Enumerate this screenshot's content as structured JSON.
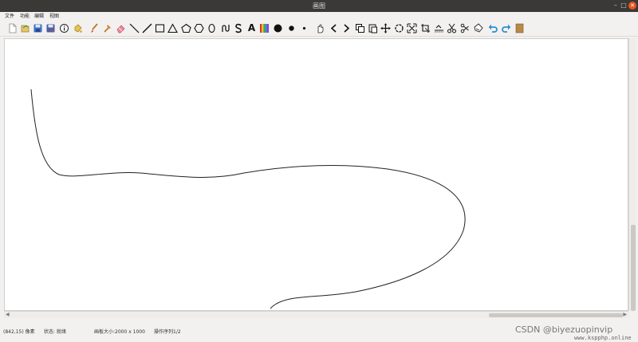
{
  "window": {
    "title": "画图"
  },
  "menu": {
    "file": "文件",
    "function": "功能",
    "edit": "编辑",
    "view": "视图"
  },
  "toolbar": {
    "tools": [
      "new-file-icon",
      "open-file-icon",
      "save-icon",
      "save-as-icon",
      "info-icon",
      "fill-bucket-icon",
      "brush-icon",
      "hammer-icon",
      "eraser-icon",
      "line-thin-icon",
      "line-thick-icon",
      "rectangle-icon",
      "triangle-icon",
      "pentagon-icon",
      "polygon-icon",
      "ellipse-icon",
      "curve-icon",
      "s-curve-icon",
      "text-icon",
      "color-palette-icon",
      "large-dot-icon",
      "medium-dot-icon",
      "small-dot-icon",
      "hand-icon",
      "chevron-left-icon",
      "chevron-right-icon",
      "copy-icon",
      "paste-icon",
      "move-icon",
      "rotate-icon",
      "resize-icon",
      "crop-icon",
      "skew-icon",
      "cut-icon",
      "shear-icon",
      "bucket-hand-icon",
      "undo-icon",
      "redo-icon",
      "background-icon"
    ],
    "text_glyph": "A"
  },
  "colors": {
    "titlebar": "#3a3935",
    "close": "#e9541f",
    "undo": "#2b8fd1",
    "save": "#3a6ec4",
    "background_swatch": "#b88a4a"
  },
  "status": {
    "coordinates": "(842,15) 像素",
    "state": "状态: 就绪",
    "canvas_size": "画板大小:2000 x 1000",
    "operations": "操作序列1/2"
  },
  "watermark": {
    "text": "CSDN @biyezuopinvip",
    "subtext": "www.kspphp.online"
  }
}
